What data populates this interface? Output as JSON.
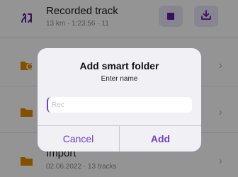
{
  "list": {
    "items": [
      {
        "title": "Recorded track",
        "subtitle": "13 km · 1:23:56 · 11",
        "icon": "track-route-icon"
      },
      {
        "title": "",
        "subtitle": "",
        "icon": "map-pin-folder-icon"
      },
      {
        "title": "",
        "subtitle": "",
        "icon": "folder-icon"
      },
      {
        "title": "Import",
        "subtitle": "02.06.2022 · 13 tracks",
        "icon": "folder-icon"
      }
    ],
    "stop_button_icon": "stop-icon",
    "save_button_icon": "download-icon"
  },
  "dialog": {
    "title": "Add smart folder",
    "message": "Enter name",
    "input_value": "",
    "input_placeholder": "Rec",
    "cancel_label": "Cancel",
    "add_label": "Add"
  },
  "colors": {
    "accent": "#6f40c9",
    "accent_dark": "#5a1f9f",
    "folder": "#e08a00",
    "button_bg": "#e9e6f7"
  }
}
